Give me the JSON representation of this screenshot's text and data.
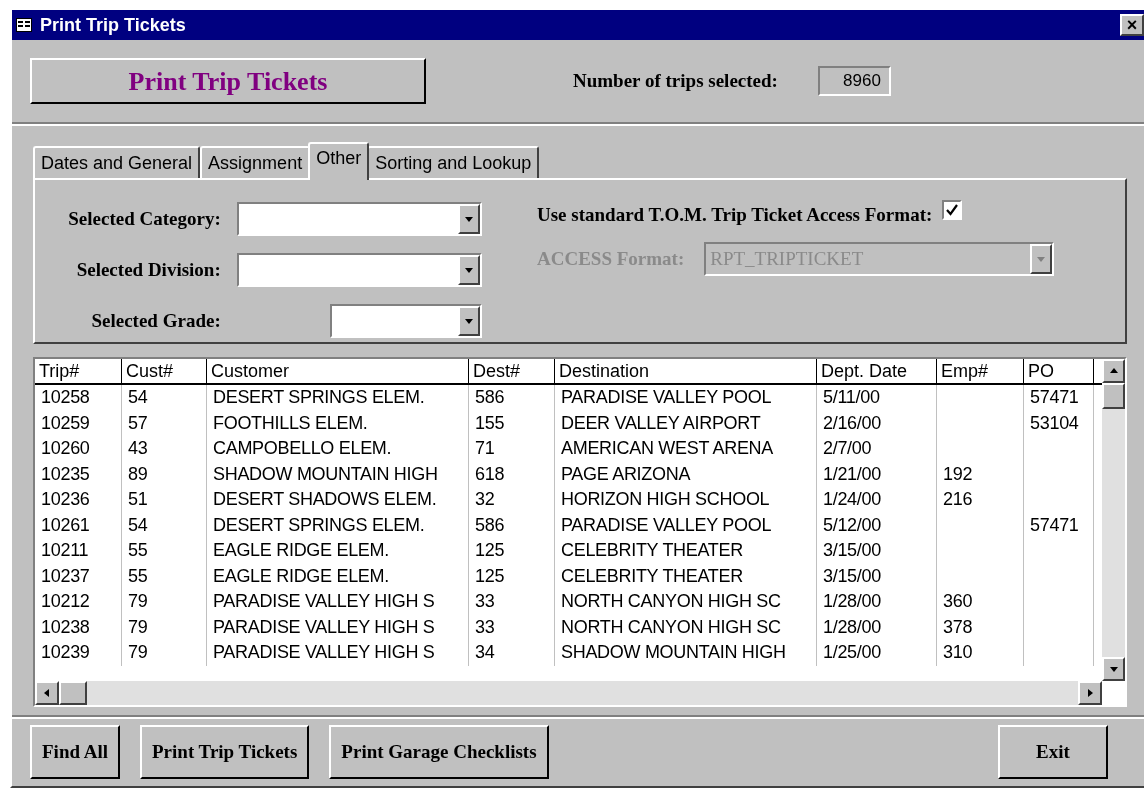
{
  "window": {
    "title": "Print Trip Tickets",
    "close_label": "×"
  },
  "header": {
    "main_button": "Print Trip Tickets",
    "count_label": "Number of trips selected:",
    "count_value": "8960"
  },
  "tabs": [
    {
      "label": "Dates and General",
      "selected": false
    },
    {
      "label": "Assignment",
      "selected": false
    },
    {
      "label": "Other",
      "selected": true
    },
    {
      "label": "Sorting and Lookup",
      "selected": false
    }
  ],
  "filters": [
    {
      "label": "Selected Category:"
    },
    {
      "label": "Selected Division:"
    },
    {
      "label": "Selected Grade:"
    }
  ],
  "format": {
    "checkbox_label": "Use standard T.O.M. Trip Ticket Access Format:",
    "checked": true,
    "format_label": "ACCESS Format:",
    "format_value": "RPT_TRIPTICKET",
    "disabled": true
  },
  "table": {
    "columns": [
      "Trip#",
      "Cust#",
      "Customer",
      "Dest#",
      "Destination",
      "Dept. Date",
      "Emp#",
      "PO"
    ],
    "rows": [
      [
        "10258",
        "54",
        "DESERT SPRINGS ELEM.",
        "586",
        "PARADISE VALLEY POOL",
        "5/11/00",
        "",
        "57471"
      ],
      [
        "10259",
        "57",
        "FOOTHILLS ELEM.",
        "155",
        "DEER VALLEY AIRPORT",
        "2/16/00",
        "",
        "53104"
      ],
      [
        "10260",
        "43",
        "CAMPOBELLO ELEM.",
        "71",
        "AMERICAN WEST ARENA",
        "2/7/00",
        "",
        ""
      ],
      [
        "10235",
        "89",
        "SHADOW MOUNTAIN HIGH",
        "618",
        "PAGE ARIZONA",
        "1/21/00",
        "192",
        ""
      ],
      [
        "10236",
        "51",
        "DESERT SHADOWS ELEM.",
        "32",
        "HORIZON HIGH SCHOOL",
        "1/24/00",
        "216",
        ""
      ],
      [
        "10261",
        "54",
        "DESERT SPRINGS ELEM.",
        "586",
        "PARADISE VALLEY POOL",
        "5/12/00",
        "",
        "57471"
      ],
      [
        "10211",
        "55",
        "EAGLE RIDGE ELEM.",
        "125",
        "CELEBRITY THEATER",
        "3/15/00",
        "",
        ""
      ],
      [
        "10237",
        "55",
        "EAGLE RIDGE ELEM.",
        "125",
        "CELEBRITY THEATER",
        "3/15/00",
        "",
        ""
      ],
      [
        "10212",
        "79",
        "PARADISE VALLEY HIGH S",
        "33",
        "NORTH CANYON HIGH SC",
        "1/28/00",
        "360",
        ""
      ],
      [
        "10238",
        "79",
        "PARADISE VALLEY HIGH S",
        "33",
        "NORTH CANYON HIGH SC",
        "1/28/00",
        "378",
        ""
      ],
      [
        "10239",
        "79",
        "PARADISE VALLEY HIGH S",
        "34",
        "SHADOW MOUNTAIN HIGH",
        "1/25/00",
        "310",
        ""
      ]
    ]
  },
  "footer_buttons": [
    "Find All",
    "Print Trip Tickets",
    "Print Garage Checklists",
    "Exit"
  ]
}
